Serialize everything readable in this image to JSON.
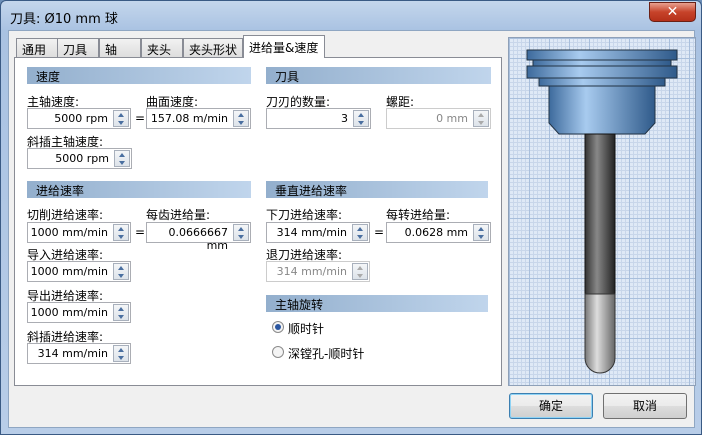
{
  "window": {
    "title": "刀具: Ø10 mm 球",
    "close": "✕"
  },
  "tabs": [
    {
      "label": "通用"
    },
    {
      "label": "刀具"
    },
    {
      "label": "轴"
    },
    {
      "label": "夹头"
    },
    {
      "label": "夹头形状"
    },
    {
      "label": "进给量&速度",
      "active": true
    }
  ],
  "speed": {
    "header": "速度",
    "spindle_label": "主轴速度:",
    "spindle_value": "5000 rpm",
    "surface_label": "曲面速度:",
    "surface_value": "157.08 m/min",
    "ramp_spindle_label": "斜插主轴速度:",
    "ramp_spindle_value": "5000 rpm"
  },
  "tool": {
    "header": "刀具",
    "flutes_label": "刀刃的数量:",
    "flutes_value": "3",
    "pitch_label": "螺距:",
    "pitch_value": "0 mm"
  },
  "feed": {
    "header": "进给速率",
    "cutting_label": "切削进给速率:",
    "cutting_value": "1000 mm/min",
    "per_tooth_label": "每齿进给量:",
    "per_tooth_value": "0.0666667 mm",
    "lead_in_label": "导入进给速率:",
    "lead_in_value": "1000 mm/min",
    "lead_out_label": "导出进给速率:",
    "lead_out_value": "1000 mm/min",
    "ramp_label": "斜插进给速率:",
    "ramp_value": "314 mm/min"
  },
  "vertical": {
    "header": "垂直进给速率",
    "plunge_label": "下刀进给速率:",
    "plunge_value": "314 mm/min",
    "per_rev_label": "每转进给量:",
    "per_rev_value": "0.0628 mm",
    "retract_label": "退刀进给速率:",
    "retract_value": "314 mm/min"
  },
  "rotation": {
    "header": "主轴旋转",
    "options": [
      {
        "label": "顺时针",
        "selected": true
      },
      {
        "label": "深镗孔-顺时针",
        "selected": false
      }
    ]
  },
  "equals": "=",
  "buttons": {
    "ok": "确定",
    "cancel": "取消"
  }
}
